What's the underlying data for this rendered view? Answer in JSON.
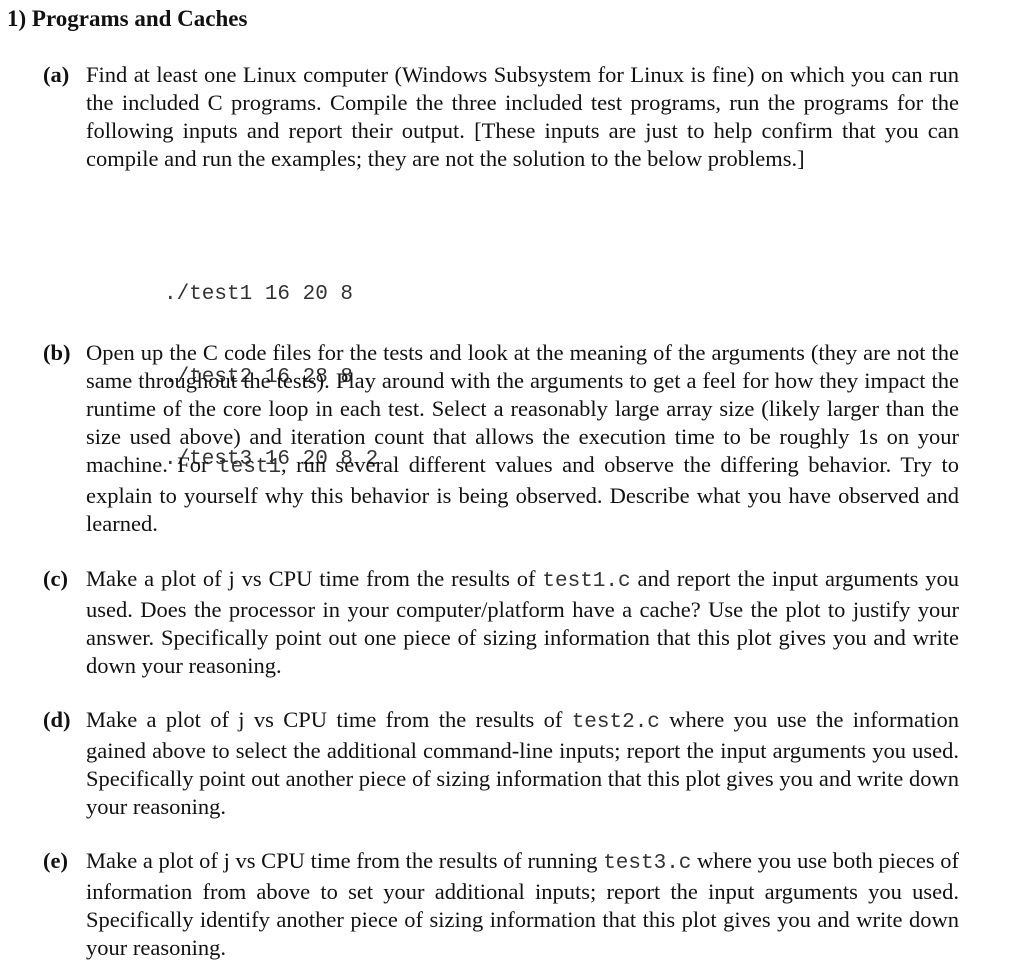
{
  "document": {
    "heading": "1) Programs and Caches",
    "parts": [
      {
        "label": "(a)",
        "segments": [
          {
            "text": "Find at least one Linux computer (Windows Subsystem for Linux is fine) on which you can run the included C programs. Compile the three included test programs, run the programs for the following inputs and report their output. [These inputs are just to help confirm that you can compile and run the examples; they are not the solution to the below problems.]"
          }
        ]
      },
      {
        "label": "(b)",
        "segments": [
          {
            "text": "Open up the C code files for the tests and look at the meaning of the arguments (they are not the same throughout the tests). Play around with the arguments to get a feel for how they impact the runtime of the core loop in each test. Select a reasonably large array size (likely larger than the size used above) and iteration count that allows the execution time to be roughly 1s on your machine. For "
          },
          {
            "code": "test1"
          },
          {
            "text": ", run several different values and observe the differing behavior. Try to explain to yourself why this behavior is being observed. Describe what you have observed and learned."
          }
        ]
      },
      {
        "label": "(c)",
        "segments": [
          {
            "text": "Make a plot of j vs CPU time from the results of "
          },
          {
            "code": "test1.c"
          },
          {
            "text": " and report the input arguments you used. Does the processor in your computer/platform have a cache? Use the plot to justify your answer. Specifically point out one piece of sizing information that this plot gives you and write down your reasoning."
          }
        ]
      },
      {
        "label": "(d)",
        "segments": [
          {
            "text": "Make a plot of j vs CPU time from the results of "
          },
          {
            "code": "test2.c"
          },
          {
            "text": " where you use the information gained above to select the additional command-line inputs; report the input arguments you used. Specifically point out another piece of sizing information that this plot gives you and write down your reasoning."
          }
        ]
      },
      {
        "label": "(e)",
        "segments": [
          {
            "text": "Make a plot of j vs CPU time from the results of running "
          },
          {
            "code": "test3.c"
          },
          {
            "text": " where you use both pieces of information from above to set your additional inputs; report the input arguments you used. Specifically identify another piece of sizing information that this plot gives you and write down your reasoning."
          }
        ]
      }
    ],
    "commands": [
      "./test1 16 20 8",
      "./test2 16 28 8",
      "./test3 16 20 8 2"
    ]
  }
}
